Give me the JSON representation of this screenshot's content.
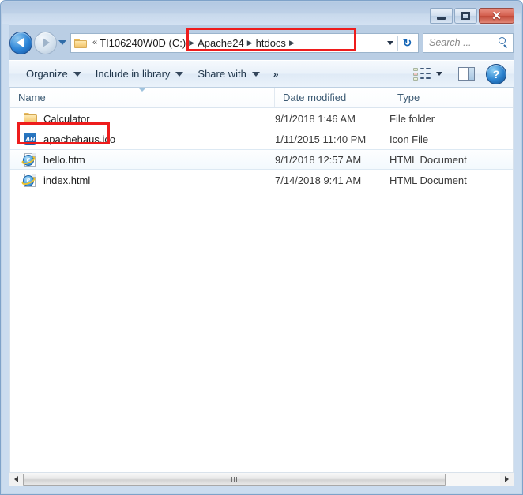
{
  "window": {
    "title": "",
    "controls": {
      "minimize_label": "–",
      "maximize_label": "□",
      "close_label": "✕"
    }
  },
  "navigation": {
    "back_label": "Back",
    "forward_label": "Forward",
    "recent_pages_label": "Recent pages",
    "refresh_label": "↻"
  },
  "address_bar": {
    "folder_icon": "folder-icon",
    "overflow_chevron": "«",
    "separator": "▶",
    "crumbs": [
      {
        "label": "TI106240W0D (C:)"
      },
      {
        "label": "Apache24"
      },
      {
        "label": "htdocs"
      }
    ],
    "dropdown_label": "Previous locations"
  },
  "search": {
    "placeholder": "Search ...",
    "value": "",
    "icon": "search-icon"
  },
  "toolbar": {
    "items": [
      {
        "label": "Organize",
        "has_caret": true
      },
      {
        "label": "Include in library",
        "has_caret": true
      },
      {
        "label": "Share with",
        "has_caret": true
      }
    ],
    "overflow_label": "»",
    "change_view_label": "Change your view",
    "preview_pane_label": "Show the preview pane",
    "help_label": "?"
  },
  "columns": [
    {
      "key": "name",
      "label": "Name",
      "sorted": true,
      "sort_direction": "ascending"
    },
    {
      "key": "date",
      "label": "Date modified",
      "sorted": false
    },
    {
      "key": "type",
      "label": "Type",
      "sorted": false
    }
  ],
  "files": [
    {
      "name": "Calculator",
      "date_modified": "9/1/2018 1:46 AM",
      "type": "File folder",
      "icon": "folder-icon",
      "state": "normal"
    },
    {
      "name": "apachehaus.ico",
      "date_modified": "1/11/2015 11:40 PM",
      "type": "Icon File",
      "icon": "apachehaus-ico-icon",
      "icon_text": "AH",
      "state": "normal"
    },
    {
      "name": "hello.htm",
      "date_modified": "9/1/2018 12:57 AM",
      "type": "HTML Document",
      "icon": "internet-explorer-document-icon",
      "state": "hover"
    },
    {
      "name": "index.html",
      "date_modified": "7/14/2018 9:41 AM",
      "type": "HTML Document",
      "icon": "internet-explorer-document-icon",
      "state": "normal"
    }
  ],
  "scrollbar": {
    "left_arrow": "◀",
    "right_arrow": "▶",
    "orientation": "horizontal"
  },
  "annotations": [
    {
      "name": "path-highlight",
      "target": "address bar path (C:) ▶ Apache24 ▶ htdocs ▶",
      "color": "#ee1c1c"
    },
    {
      "name": "calculator-highlight",
      "target": "Calculator folder row",
      "color": "#ee1c1c"
    }
  ],
  "colors": {
    "annotation_red": "#ee1c1c",
    "window_border": "#7ea2c9",
    "titlebar_top": "#b2c8e2",
    "close_button": "#c14a39",
    "header_text": "#3c5a73"
  }
}
